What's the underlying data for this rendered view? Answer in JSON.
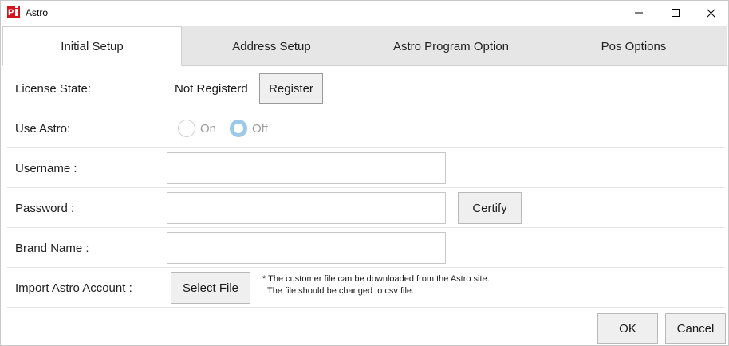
{
  "window": {
    "title": "Astro",
    "app_icon": "pi-app-icon",
    "controls": {
      "minimize": "minimize-icon",
      "maximize": "maximize-icon",
      "close": "close-icon"
    }
  },
  "tabs": [
    {
      "label": "Initial Setup",
      "active": true
    },
    {
      "label": "Address Setup",
      "active": false
    },
    {
      "label": "Astro Program Option",
      "active": false
    },
    {
      "label": "Pos Options",
      "active": false
    }
  ],
  "form": {
    "license": {
      "label": "License State:",
      "status": "Not Registerd",
      "button": "Register"
    },
    "use_astro": {
      "label": "Use Astro:",
      "on_label": "On",
      "off_label": "Off",
      "selected": "Off"
    },
    "username": {
      "label": "Username :",
      "value": ""
    },
    "password": {
      "label": "Password :",
      "value": "",
      "button": "Certify"
    },
    "brand_name": {
      "label": "Brand Name :",
      "value": ""
    },
    "import": {
      "label": "Import Astro Account :",
      "button": "Select File",
      "note_line1": "* The customer file can be downloaded from the Astro site.",
      "note_line2": "The file should be changed to csv file."
    }
  },
  "footer": {
    "ok": "OK",
    "cancel": "Cancel"
  },
  "colors": {
    "radio_selected": "#9cc8ea",
    "tab_strip": "#e6e6e6",
    "icon_red": "#d4161c"
  }
}
